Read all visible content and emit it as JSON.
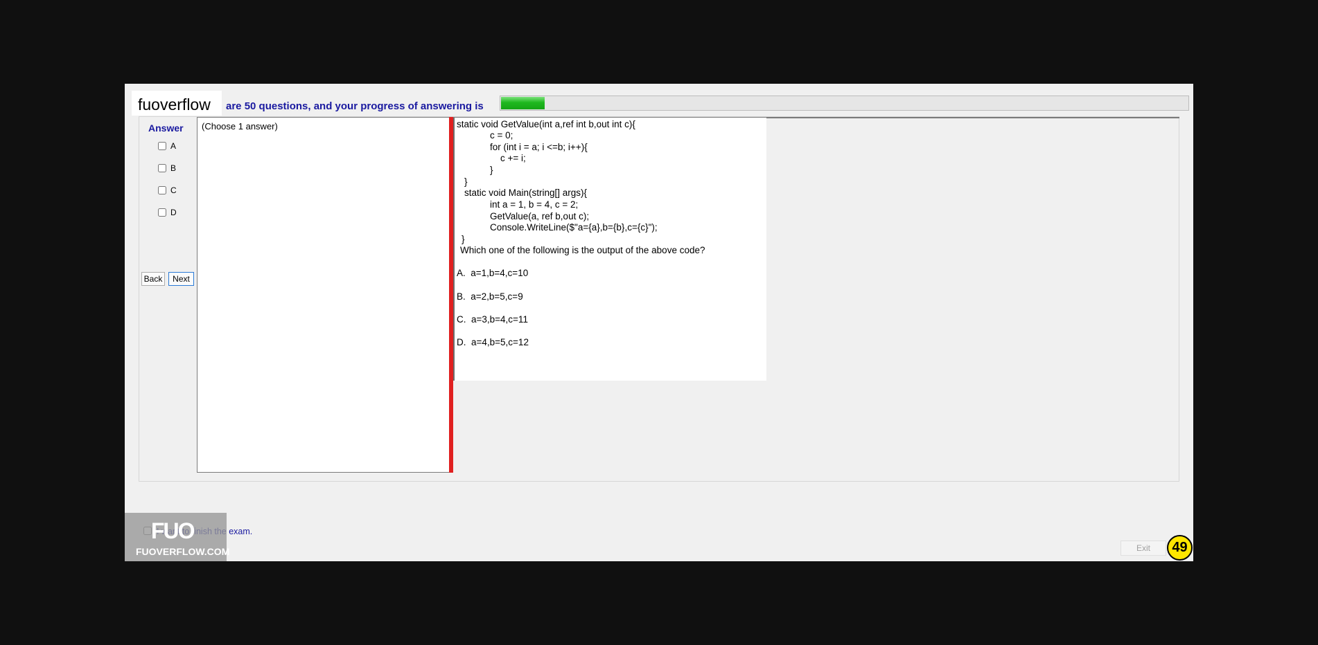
{
  "header": {
    "logo_text": "fuoverflow",
    "progress_label": "are 50 questions, and your progress of answering is",
    "progress_fraction": 0.064
  },
  "answer_panel": {
    "title": "Answer",
    "options": [
      "A",
      "B",
      "C",
      "D"
    ],
    "back_label": "Back",
    "next_label": "Next",
    "choose_text": "(Choose 1 answer)"
  },
  "question": {
    "code_lines": [
      "static void GetValue(int a,ref int b,out int c){",
      "c = 0;",
      "for (int i = a; i <=b; i++){",
      "c += i;",
      "}",
      "}",
      "static void Main(string[] args){",
      "int a = 1, b = 4, c = 2;",
      "GetValue(a, ref b,out c);",
      "Console.WriteLine($\"a={a},b={b},c={c}\");",
      "}"
    ],
    "prompt": "Which one of the following is the output of the above code?",
    "choices": [
      "A.  a=1,b=4,c=10",
      "B.  a=2,b=5,c=9",
      "C.  a=3,b=4,c=11",
      "D.  a=4,b=5,c=12"
    ]
  },
  "footer": {
    "finish_label": "I want to finish the exam.",
    "exit_label": "Exit",
    "question_number": "49"
  },
  "watermark": {
    "logo": "FUO",
    "site": "FUOVERFLOW.COM"
  }
}
